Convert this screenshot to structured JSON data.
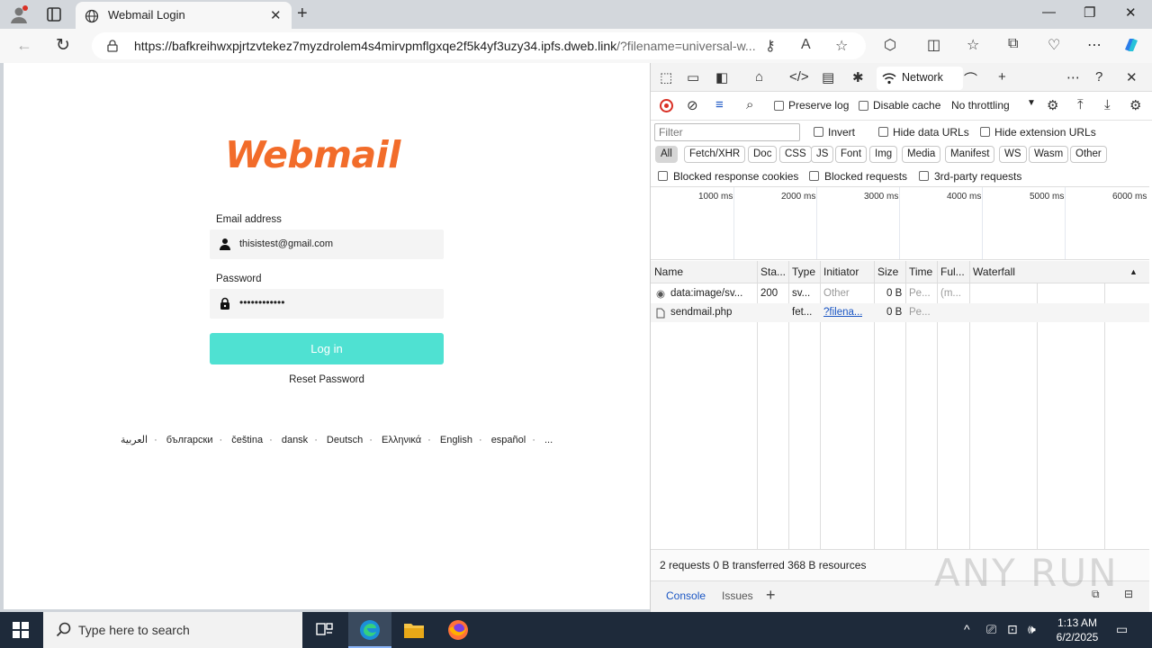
{
  "browser": {
    "tab_title": "Webmail Login",
    "url_main": "https://bafkreihwxpjrtzvtekez7myzdrolem4s4mirvpmflgxqe2f5k4yf3uzy34.ipfs.dweb.link",
    "url_rest": "/?filename=universal-w..."
  },
  "page": {
    "logo": "Webmail",
    "email_label": "Email address",
    "email_value": "thisistest@gmail.com",
    "password_label": "Password",
    "password_value": "••••••••••••",
    "login_button": "Log in",
    "reset_link": "Reset Password",
    "languages": [
      "العربية",
      "български",
      "čeština",
      "dansk",
      "Deutsch",
      "Ελληνικά",
      "English",
      "español",
      "..."
    ]
  },
  "devtools": {
    "active_tab": "Network",
    "preserve_log": "Preserve log",
    "disable_cache": "Disable cache",
    "throttling": "No throttling",
    "filter_placeholder": "Filter",
    "invert": "Invert",
    "hide_data_urls": "Hide data URLs",
    "hide_extension_urls": "Hide extension URLs",
    "type_filters": [
      "All",
      "Fetch/XHR",
      "Doc",
      "CSS",
      "JS",
      "Font",
      "Img",
      "Media",
      "Manifest",
      "WS",
      "Wasm",
      "Other"
    ],
    "blocked_response_cookies": "Blocked response cookies",
    "blocked_requests": "Blocked requests",
    "third_party": "3rd-party requests",
    "timeline_ticks": [
      "1000 ms",
      "2000 ms",
      "3000 ms",
      "4000 ms",
      "5000 ms",
      "6000 ms"
    ],
    "columns": [
      "Name",
      "Sta...",
      "Type",
      "Initiator",
      "Size",
      "Time",
      "Ful...",
      "Waterfall"
    ],
    "rows": [
      {
        "name": "data:image/sv...",
        "status": "200",
        "type": "sv...",
        "initiator": "Other",
        "size": "0 B",
        "time": "Pe...",
        "fulfilled": "(m..."
      },
      {
        "name": "sendmail.php",
        "status": "",
        "type": "fet...",
        "initiator": "?filena...",
        "size": "0 B",
        "time": "Pe...",
        "fulfilled": ""
      }
    ],
    "summary": "2 requests  0 B transferred  368 B resources",
    "drawer_tabs": [
      "Console",
      "Issues"
    ]
  },
  "watermark": "ANY RUN",
  "taskbar": {
    "search_placeholder": "Type here to search",
    "time": "1:13 AM",
    "date": "6/2/2025"
  },
  "colors": {
    "logo": "#f26c2a",
    "login_button": "#4fe1d2",
    "record": "#d93025",
    "link": "#1a56c4"
  }
}
